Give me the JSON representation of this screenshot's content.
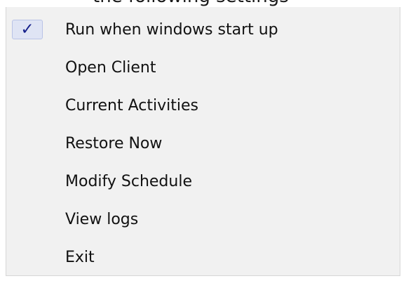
{
  "top_text": "the following settings",
  "menu": {
    "items": [
      {
        "label": "Run when windows start up",
        "checked": true
      },
      {
        "label": "Open Client",
        "checked": false
      },
      {
        "label": "Current Activities",
        "checked": false
      },
      {
        "label": "Restore Now",
        "checked": false
      },
      {
        "label": "Modify Schedule",
        "checked": false
      },
      {
        "label": "View logs",
        "checked": false
      },
      {
        "label": "Exit",
        "checked": false
      }
    ],
    "check_symbol": "✓",
    "check_icon_name": "checkmark-icon",
    "colors": {
      "background": "#f1f1f1",
      "check_highlight": "#dfe4f4",
      "check_color": "#141f8a"
    }
  }
}
